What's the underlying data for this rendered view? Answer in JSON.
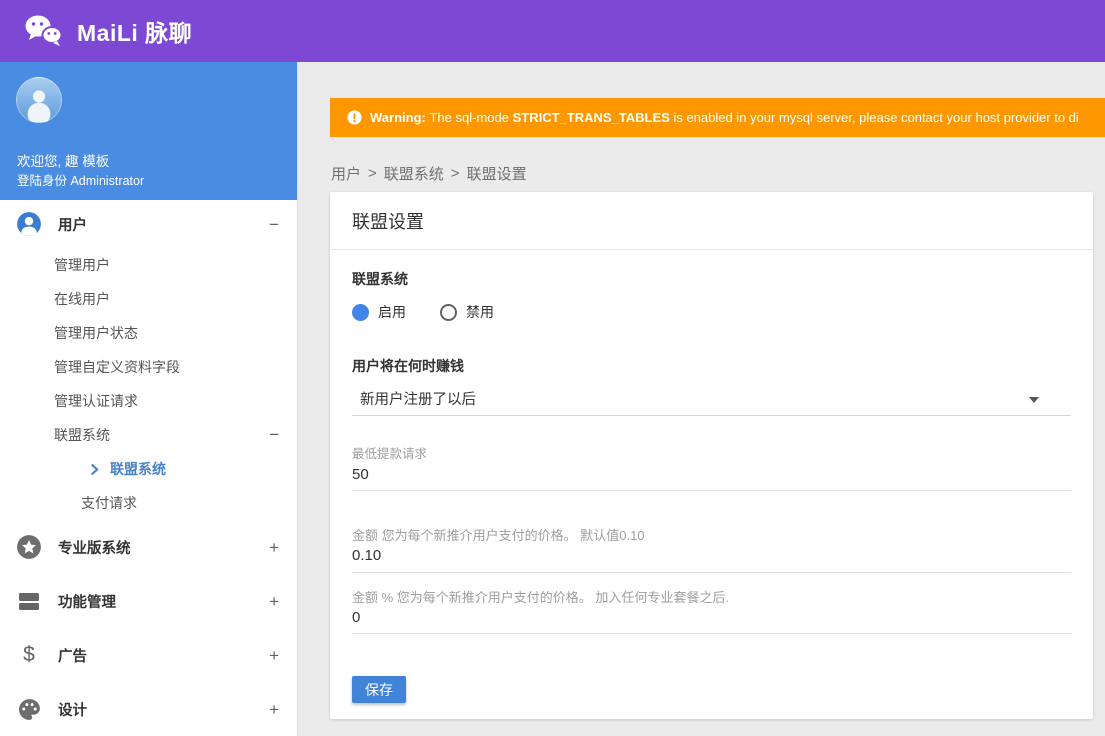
{
  "colors": {
    "header_purple": "#7d49d4",
    "sidebar_blue": "#4a8ce2",
    "warning_orange": "#ff9800",
    "save_button_blue": "#4183d7",
    "radio_selected_blue": "#4285e8",
    "active_link_blue": "#4a82c8"
  },
  "header": {
    "title": "MaiLi 脉聊"
  },
  "sidebar": {
    "profile": {
      "welcome": "欢迎您, 趣 模板",
      "role": "登陆身份 Administrator"
    },
    "menu": {
      "users": {
        "label": "用户",
        "toggle": "−"
      },
      "users_children": [
        "管理用户",
        "在线用户",
        "管理用户状态",
        "管理自定义资料字段",
        "管理认证请求"
      ],
      "affiliate_group": {
        "label": "联盟系统",
        "toggle": "−"
      },
      "affiliate_active": {
        "label": "联盟系统"
      },
      "payment_request": {
        "label": "支付请求"
      },
      "pro": {
        "label": "专业版系统",
        "toggle": "+"
      },
      "features": {
        "label": "功能管理",
        "toggle": "+"
      },
      "ads": {
        "label": "广告",
        "toggle": "+"
      },
      "design": {
        "label": "设计",
        "toggle": "+"
      }
    }
  },
  "content": {
    "warning": {
      "bold": "Warning:",
      "seg1": "The sql-mode",
      "strong": "STRICT_TRANS_TABLES",
      "seg2": "is enabled in your mysql server, please contact your host provider to di"
    },
    "breadcrumb": {
      "items": [
        "用户",
        "联盟系统",
        "联盟设置"
      ],
      "separator": ">"
    },
    "card": {
      "title": "联盟设置",
      "affiliate_system": {
        "label": "联盟系统",
        "enable": "启用",
        "disable": "禁用",
        "selected": "启用"
      },
      "earn_when": {
        "label": "用户将在何时赚钱",
        "value": "新用户注册了以后"
      },
      "min_withdraw": {
        "label": "最低提款请求",
        "value": "50"
      },
      "amount": {
        "label": "金额 您为每个新推介用户支付的价格。 默认值0.10",
        "value": "0.10"
      },
      "amount_percent": {
        "label": "金额 % 您为每个新推介用户支付的价格。 加入任何专业套餐之后.",
        "value": "0"
      },
      "save_label": "保存"
    }
  }
}
